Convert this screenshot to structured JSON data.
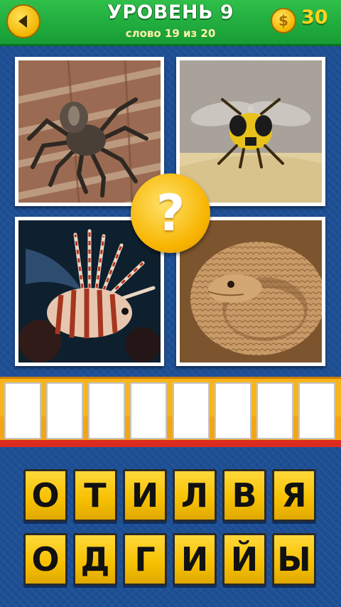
{
  "header": {
    "level_title": "УРОВЕНЬ 9",
    "word_progress": "слово 19 из 20",
    "coin_symbol": "$",
    "coins": "30",
    "back_icon": "arrow-left-icon"
  },
  "pictures": [
    {
      "subject": "spider"
    },
    {
      "subject": "wasp"
    },
    {
      "subject": "lionfish"
    },
    {
      "subject": "snake"
    }
  ],
  "question_mark": "?",
  "answer": {
    "slot_count": 8,
    "slots": [
      "",
      "",
      "",
      "",
      "",
      "",
      "",
      ""
    ]
  },
  "letters": {
    "row1": [
      "О",
      "Т",
      "И",
      "Л",
      "В",
      "Я"
    ],
    "row2": [
      "О",
      "Д",
      "Г",
      "И",
      "Й",
      "Ы"
    ]
  },
  "colors": {
    "header_green": "#1fae3c",
    "background_blue": "#1d4f95",
    "tile_yellow": "#f6c000",
    "answer_bar_orange": "#f8b51b",
    "answer_bar_red": "#d92b1e"
  }
}
